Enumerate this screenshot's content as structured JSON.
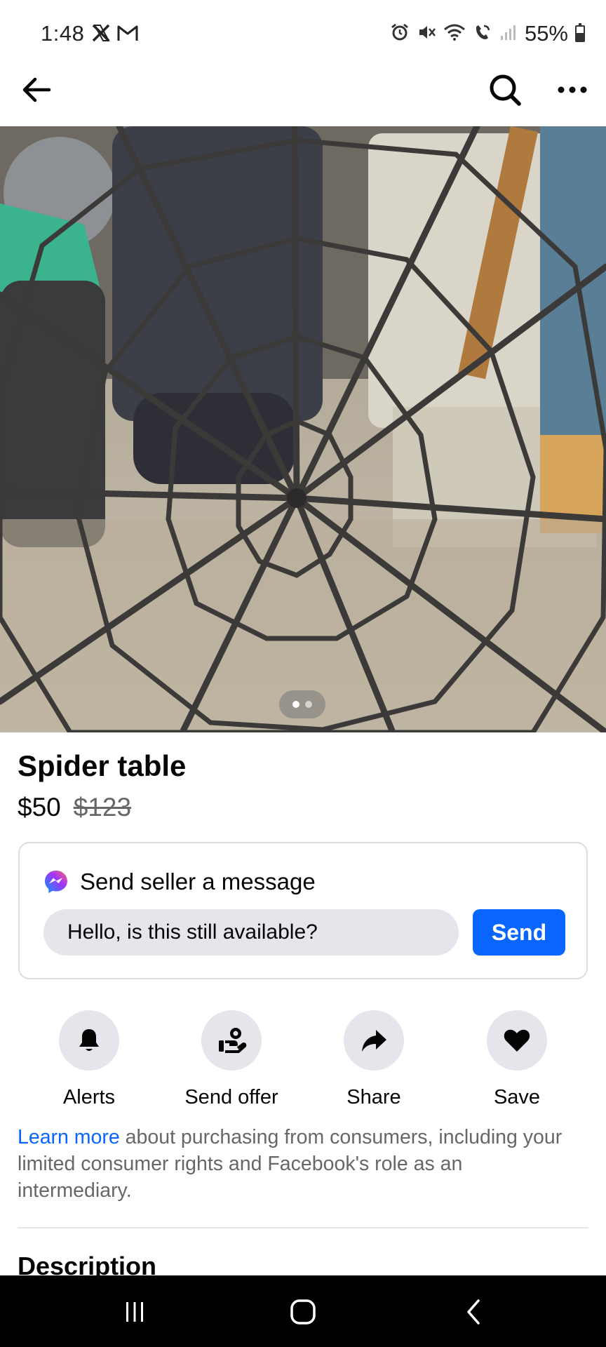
{
  "status_bar": {
    "time": "1:48",
    "battery": "55%",
    "left_icons": [
      "x-icon",
      "gmail-icon"
    ],
    "right_icons": [
      "alarm-icon",
      "mute-icon",
      "wifi-icon",
      "wifi-calling-icon",
      "signal-icon",
      "battery-icon"
    ]
  },
  "header": {
    "icons": [
      "back-arrow-icon",
      "search-icon",
      "more-icon"
    ]
  },
  "photo": {
    "page_count": 2,
    "current_page": 1
  },
  "listing": {
    "title": "Spider table",
    "price": "$50",
    "original_price": "$123"
  },
  "message": {
    "title": "Send seller a message",
    "input_value": "Hello, is this still available?",
    "send_label": "Send",
    "icon": "messenger-icon"
  },
  "actions": [
    {
      "label": "Alerts",
      "icon": "bell-icon"
    },
    {
      "label": "Send offer",
      "icon": "offer-icon"
    },
    {
      "label": "Share",
      "icon": "share-icon"
    },
    {
      "label": "Save",
      "icon": "heart-icon"
    }
  ],
  "disclaimer": {
    "link": "Learn more",
    "text": " about purchasing from consumers, including your limited consumer rights and Facebook's role as an intermediary."
  },
  "description_heading": "Description",
  "nav_bar": {
    "icons": [
      "recents-icon",
      "home-icon",
      "back-icon"
    ]
  },
  "colors": {
    "accent": "#0866ff",
    "secondary_text": "#65676b",
    "chip_background": "#e4e6eb"
  }
}
